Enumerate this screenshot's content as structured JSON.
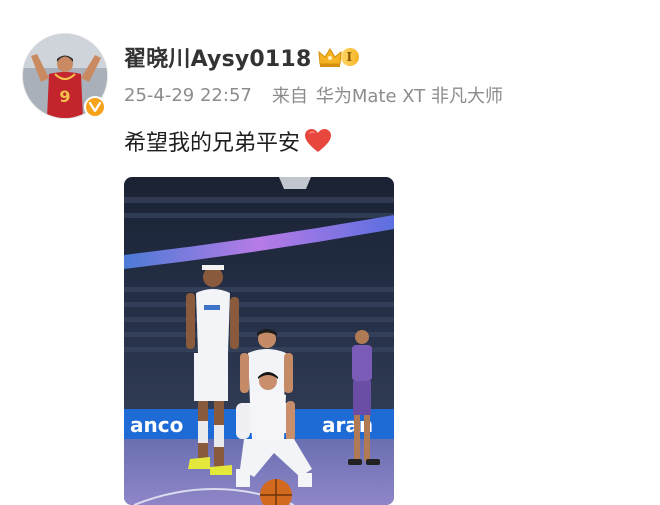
{
  "post": {
    "username": "翟晓川Aysy0118",
    "level_badge_text": "I",
    "timestamp": "25-4-29 22:57",
    "source_label": "来自",
    "device": "华为Mate XT 非凡大师",
    "content": "希望我的兄弟平安",
    "avatar_jersey_number": "9",
    "photo_banner_left": "anco",
    "photo_banner_right": "aran"
  },
  "colors": {
    "username": "#333333",
    "meta": "#8c8c8c",
    "heart": "#e8473e",
    "verified_badge": "#f7a21b",
    "level_badge": "#f5b323"
  },
  "icons": [
    "verified-v-icon",
    "crown-icon",
    "heart-icon"
  ]
}
